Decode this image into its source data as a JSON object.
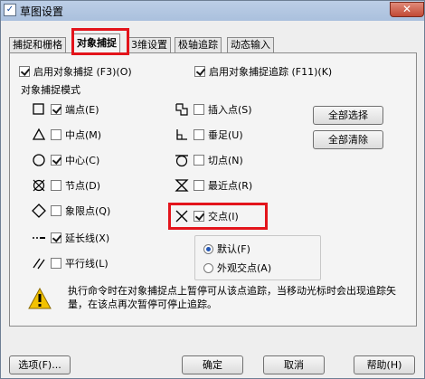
{
  "window": {
    "title": "草图设置",
    "app_icon_glyph": "✓",
    "close_glyph": "✕"
  },
  "tabs": [
    {
      "label": "捕捉和栅格",
      "active": false
    },
    {
      "label": "对象捕捉",
      "active": true
    },
    {
      "label": "3维设置",
      "active": false
    },
    {
      "label": "极轴追踪",
      "active": false
    },
    {
      "label": "动态输入",
      "active": false
    }
  ],
  "toggles": {
    "enable_snap": {
      "label": "启用对象捕捉 (F3)(O)",
      "checked": true
    },
    "enable_tracking": {
      "label": "启用对象捕捉追踪 (F11)(K)",
      "checked": true
    }
  },
  "group_title": "对象捕捉模式",
  "snap_modes_left": [
    {
      "label": "端点(E)",
      "checked": true,
      "icon": "square-endpoint-icon"
    },
    {
      "label": "中点(M)",
      "checked": false,
      "icon": "triangle-midpoint-icon"
    },
    {
      "label": "中心(C)",
      "checked": true,
      "icon": "circle-center-icon"
    },
    {
      "label": "节点(D)",
      "checked": false,
      "icon": "node-icon"
    },
    {
      "label": "象限点(Q)",
      "checked": false,
      "icon": "diamond-quadrant-icon"
    },
    {
      "label": "延长线(X)",
      "checked": true,
      "icon": "extension-icon"
    },
    {
      "label": "平行线(L)",
      "checked": false,
      "icon": "parallel-icon"
    }
  ],
  "snap_modes_right": [
    {
      "label": "插入点(S)",
      "checked": false,
      "icon": "insert-icon"
    },
    {
      "label": "垂足(U)",
      "checked": false,
      "icon": "perpendicular-icon"
    },
    {
      "label": "切点(N)",
      "checked": false,
      "icon": "tangent-icon"
    },
    {
      "label": "最近点(R)",
      "checked": false,
      "icon": "nearest-icon"
    },
    {
      "label": "交点(I)",
      "checked": true,
      "icon": "intersection-icon"
    }
  ],
  "buttons": {
    "select_all": "全部选择",
    "clear_all": "全部清除",
    "options": "选项(F)...",
    "ok": "确定",
    "cancel": "取消",
    "help": "帮助(H)"
  },
  "radio_options": [
    {
      "label": "默认(F)",
      "selected": true
    },
    {
      "label": "外观交点(A)",
      "selected": false
    }
  ],
  "notice_text": "执行命令时在对象捕捉点上暂停可从该点追踪，当移动光标时会出现追踪矢量，在该点再次暂停可停止追踪。",
  "colors": {
    "highlight_box": "#e3141b",
    "warning_yellow": "#f2c200"
  }
}
